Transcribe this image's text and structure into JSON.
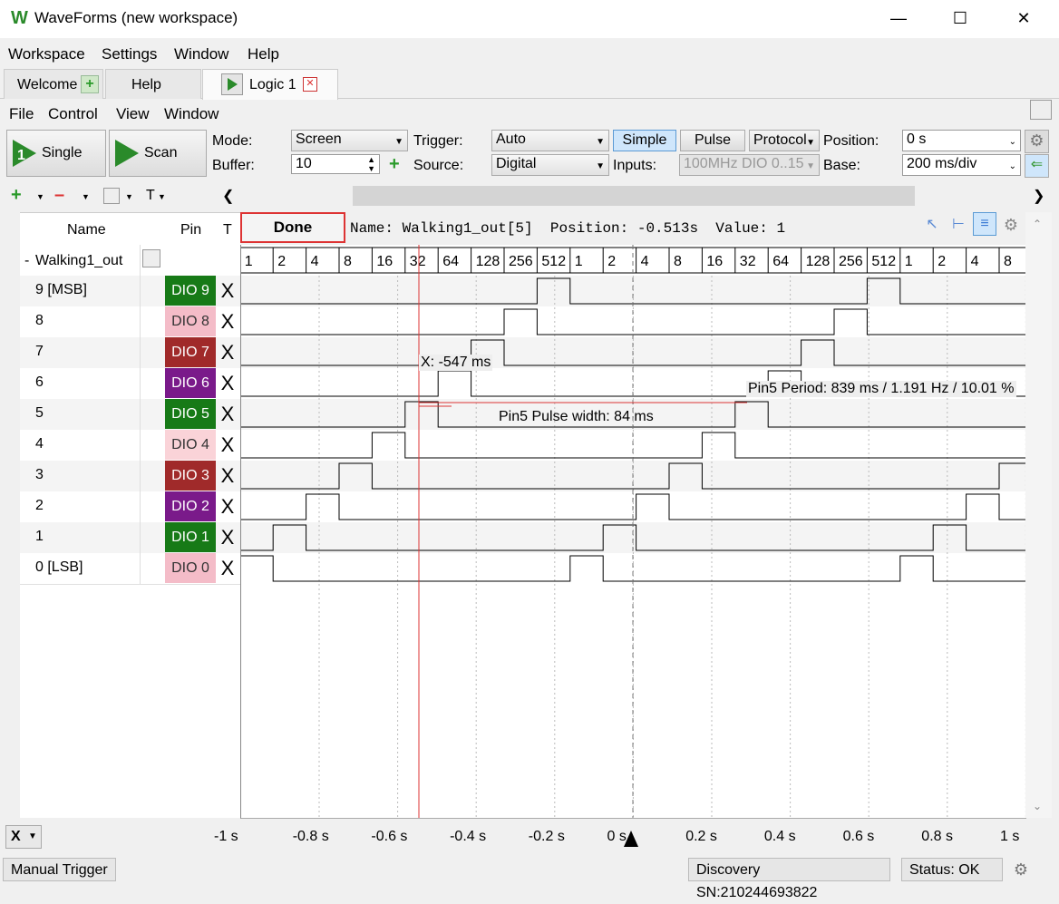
{
  "window": {
    "logo": "W",
    "title": "WaveForms  (new workspace)"
  },
  "menu": [
    "Workspace",
    "Settings",
    "Window",
    "Help"
  ],
  "tabs": [
    {
      "label": "Welcome"
    },
    {
      "label": "Help"
    },
    {
      "label": "Logic 1"
    }
  ],
  "submenu": [
    "File",
    "Control",
    "View",
    "Window"
  ],
  "toolbar": {
    "single_label": "Single",
    "scan_label": "Scan",
    "mode_label": "Mode:",
    "mode_value": "Screen",
    "buffer_label": "Buffer:",
    "buffer_value": "10",
    "trigger_label": "Trigger:",
    "trigger_value": "Auto",
    "source_label": "Source:",
    "source_value": "Digital",
    "simple_label": "Simple",
    "pulse_label": "Pulse",
    "protocol_label": "Protocol",
    "inputs_label": "Inputs:",
    "inputs_value": "100MHz DIO 0..15",
    "position_label": "Position:",
    "position_value": "0 s",
    "base_label": "Base:",
    "base_value": "200 ms/div"
  },
  "subtoolbar": {
    "text_tool": "T"
  },
  "list_header": {
    "name": "Name",
    "pin": "Pin",
    "trigger": "T"
  },
  "status_done": "Done",
  "cursor_info": "Name: Walking1_out[5]  Position: -0.513s  Value: 1",
  "bus": {
    "name": "Walking1_out",
    "prefix": "-"
  },
  "signals": [
    {
      "name": "9 [MSB]",
      "pin": "DIO  9",
      "color": "#177a17",
      "text": "#ffffff"
    },
    {
      "name": "8",
      "pin": "DIO  8",
      "color": "#f4bcc8",
      "text": "#333333"
    },
    {
      "name": "7",
      "pin": "DIO  7",
      "color": "#a02a2a",
      "text": "#ffffff"
    },
    {
      "name": "6",
      "pin": "DIO  6",
      "color": "#7a1a8a",
      "text": "#ffffff"
    },
    {
      "name": "5",
      "pin": "DIO  5",
      "color": "#177a17",
      "text": "#ffffff"
    },
    {
      "name": "4",
      "pin": "DIO  4",
      "color": "#fad3d8",
      "text": "#333333"
    },
    {
      "name": "3",
      "pin": "DIO  3",
      "color": "#a02a2a",
      "text": "#ffffff"
    },
    {
      "name": "2",
      "pin": "DIO  2",
      "color": "#7a1a8a",
      "text": "#ffffff"
    },
    {
      "name": "1",
      "pin": "DIO  1",
      "color": "#177a17",
      "text": "#ffffff"
    },
    {
      "name": "0 [LSB]",
      "pin": "DIO  0",
      "color": "#f4bcc8",
      "text": "#333333"
    }
  ],
  "trigger_mark": "X",
  "bus_values": [
    "1",
    "2",
    "4",
    "8",
    "16",
    "32",
    "64",
    "128",
    "256",
    "512",
    "1",
    "2",
    "4",
    "8",
    "16",
    "32",
    "64",
    "128",
    "256",
    "512",
    "1",
    "2",
    "4",
    "8"
  ],
  "annotations": {
    "cursor_x": "X: -547 ms",
    "period": "Pin5 Period: 839 ms / 1.191 Hz / 10.01 %",
    "pulse": "Pin5 Pulse width: 84 ms"
  },
  "time_axis": [
    "-1 s",
    "-0.8 s",
    "-0.6 s",
    "-0.4 s",
    "-0.2 s",
    "0 s",
    "0.2 s",
    "0.4 s",
    "0.6 s",
    "0.8 s",
    "1 s"
  ],
  "x_selector": "X",
  "statusbar": {
    "manual_trigger": "Manual Trigger",
    "device": "Discovery SN:210244693822",
    "status": "Status: OK"
  }
}
